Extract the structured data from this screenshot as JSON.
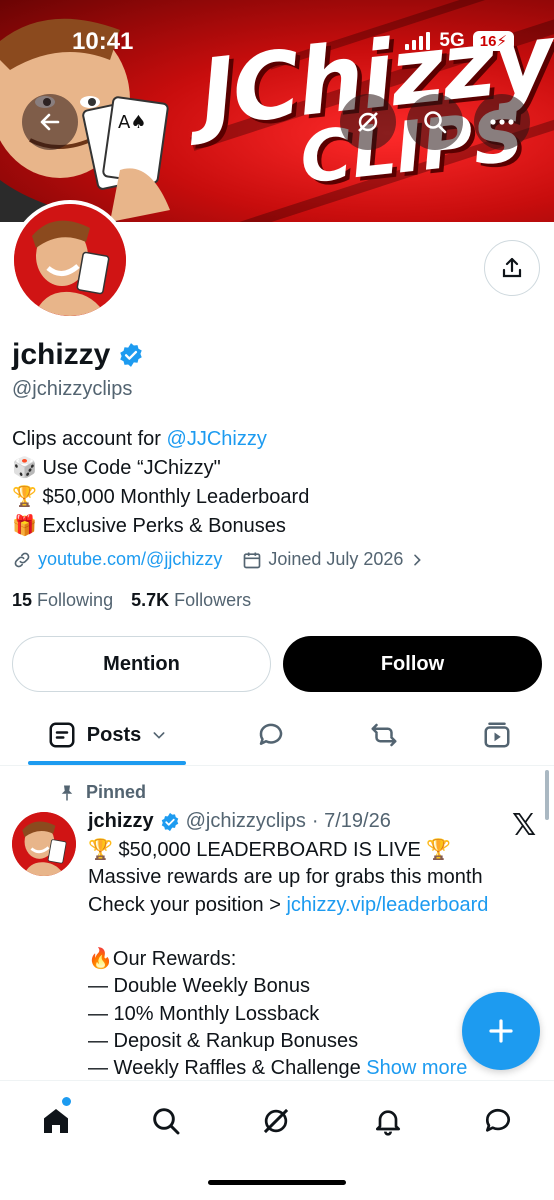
{
  "status_bar": {
    "time": "10:41",
    "network": "5G",
    "battery": "16"
  },
  "banner": {
    "title": "JChizzy",
    "subtitle": "CLIPS"
  },
  "profile": {
    "name": "jchizzy",
    "handle": "@jchizzyclips",
    "bio": {
      "line1_prefix": "Clips account for ",
      "line1_mention": "@JJChizzy",
      "line2": "🎲 Use Code “JChizzy\"",
      "line3": "🏆 $50,000 Monthly Leaderboard",
      "line4": "🎁 Exclusive Perks & Bonuses"
    },
    "website": "youtube.com/@jjchizzy",
    "joined": "Joined July 2026",
    "following_count": "15",
    "following_label": "Following",
    "followers_count": "5.7K",
    "followers_label": "Followers"
  },
  "actions": {
    "mention": "Mention",
    "follow": "Follow"
  },
  "tabs": {
    "posts": "Posts"
  },
  "post": {
    "pinned": "Pinned",
    "name": "jchizzy",
    "handle": "@jchizzyclips",
    "date": "· 7/19/26",
    "lines": [
      "🏆 $50,000 LEADERBOARD IS LIVE 🏆",
      "Massive rewards are up for grabs this month",
      "Check your position > ",
      "",
      "🔥Our Rewards:",
      "— Double Weekly Bonus",
      "— 10% Monthly Lossback",
      "— Deposit & Rankup Bonuses",
      "— Weekly Raffles & Challenge "
    ],
    "link": "jchizzy.vip/leaderboard",
    "show_more": "Show more",
    "source_logo": "𝕏"
  },
  "colors": {
    "accent": "#1d9bf0",
    "banner_red": "#c80d0d",
    "text": "#0f1419",
    "muted": "#536471"
  },
  "icons": [
    "back-arrow-icon",
    "grok-icon",
    "search-icon",
    "more-icon",
    "share-icon",
    "verified-icon",
    "link-icon",
    "calendar-icon",
    "chevron-right-icon",
    "posts-icon",
    "chevron-down-icon",
    "replies-icon",
    "reposts-icon",
    "media-icon",
    "pin-icon",
    "x-logo-icon",
    "compose-icon",
    "home-icon",
    "explore-icon",
    "notifications-icon",
    "messages-icon"
  ]
}
